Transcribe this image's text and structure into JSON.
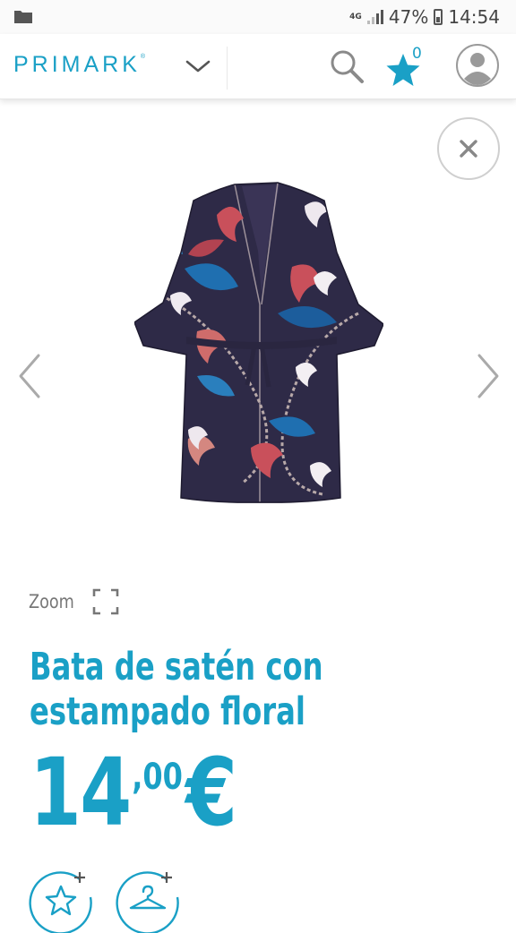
{
  "status_bar": {
    "network": "4G",
    "battery": "47%",
    "time": "14:54"
  },
  "header": {
    "brand": "PRIMARK",
    "brand_mark": "®",
    "favorites_count": "0",
    "icons": [
      "chevron-down-icon",
      "search-icon",
      "star-icon",
      "account-icon"
    ]
  },
  "gallery": {
    "icons": [
      "close-icon",
      "chevron-left-icon",
      "chevron-right-icon"
    ],
    "image": "floral-satin-robe"
  },
  "product": {
    "zoom_label": "Zoom",
    "title_line1": "Bata de satén con",
    "title_line2": "estampado floral",
    "price_integer": "14",
    "price_decimal": ",00",
    "price_currency": "€"
  },
  "actions": {
    "icons": [
      "add-to-favorites-icon",
      "add-to-wardrobe-icon"
    ]
  },
  "colors": {
    "accent": "#1aa0c6",
    "robe_base": "#2e2a47",
    "text_muted": "#777777"
  }
}
